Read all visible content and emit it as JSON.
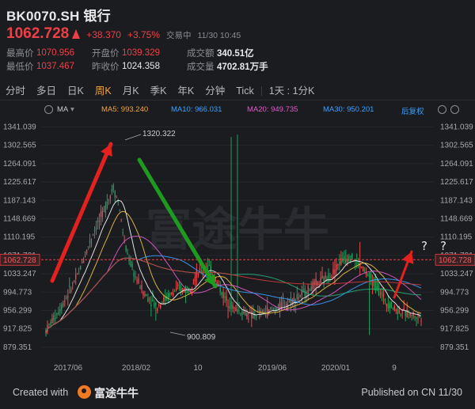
{
  "header": {
    "title": "BK0070.SH 银行",
    "price": "1062.728",
    "change": "+38.370",
    "change_pct": "+3.75%",
    "status": "交易中",
    "time": "11/30 10:45"
  },
  "stats": {
    "high_label": "最高价",
    "high": "1070.956",
    "open_label": "开盘价",
    "open": "1039.329",
    "amount_label": "成交额",
    "amount": "340.51亿",
    "low_label": "最低价",
    "low": "1037.467",
    "prev_label": "昨收价",
    "prev": "1024.358",
    "volume_label": "成交量",
    "volume": "4702.81万手"
  },
  "tabs": [
    "分时",
    "多日",
    "日K",
    "周K",
    "月K",
    "季K",
    "年K",
    "分钟",
    "Tick",
    "1天 : 1分K"
  ],
  "active_tab": "周K",
  "indicators": {
    "ma": "MA",
    "ma5": "MA5: 993.240",
    "ma10": "MA10: 966.031",
    "ma20": "MA20: 949.735",
    "ma30": "MA30: 950.201",
    "adjust": "后复权"
  },
  "chart_data": {
    "type": "candlestick",
    "y_ticks": [
      "1341.039",
      "1302.565",
      "1264.091",
      "1225.617",
      "1187.143",
      "1148.669",
      "1110.195",
      "1071.721",
      "1033.247",
      "994.773",
      "956.299",
      "917.825",
      "879.351"
    ],
    "x_ticks": [
      "2017/06",
      "2018/02",
      "10",
      "2019/06",
      "2020/01",
      "9"
    ],
    "current_price_label": "1062.728",
    "high_annotation": "1320.322",
    "low_annotation": "900.809",
    "ylim": [
      861,
      1355
    ],
    "question_marks": [
      "?",
      "?"
    ],
    "colors": {
      "up": "#e84a4f",
      "down": "#1fa05b",
      "ma5": "#f5f5f5",
      "ma10": "#f0c23a",
      "ma20": "#e05cc8",
      "ma30": "#3aa0ff",
      "ma60": "#22b07a",
      "ma120": "#d23a3a"
    }
  },
  "footer": {
    "created_with": "Created with",
    "brand": "富途牛牛",
    "published": "Published on CN 11/30"
  },
  "watermark": "富途牛牛"
}
